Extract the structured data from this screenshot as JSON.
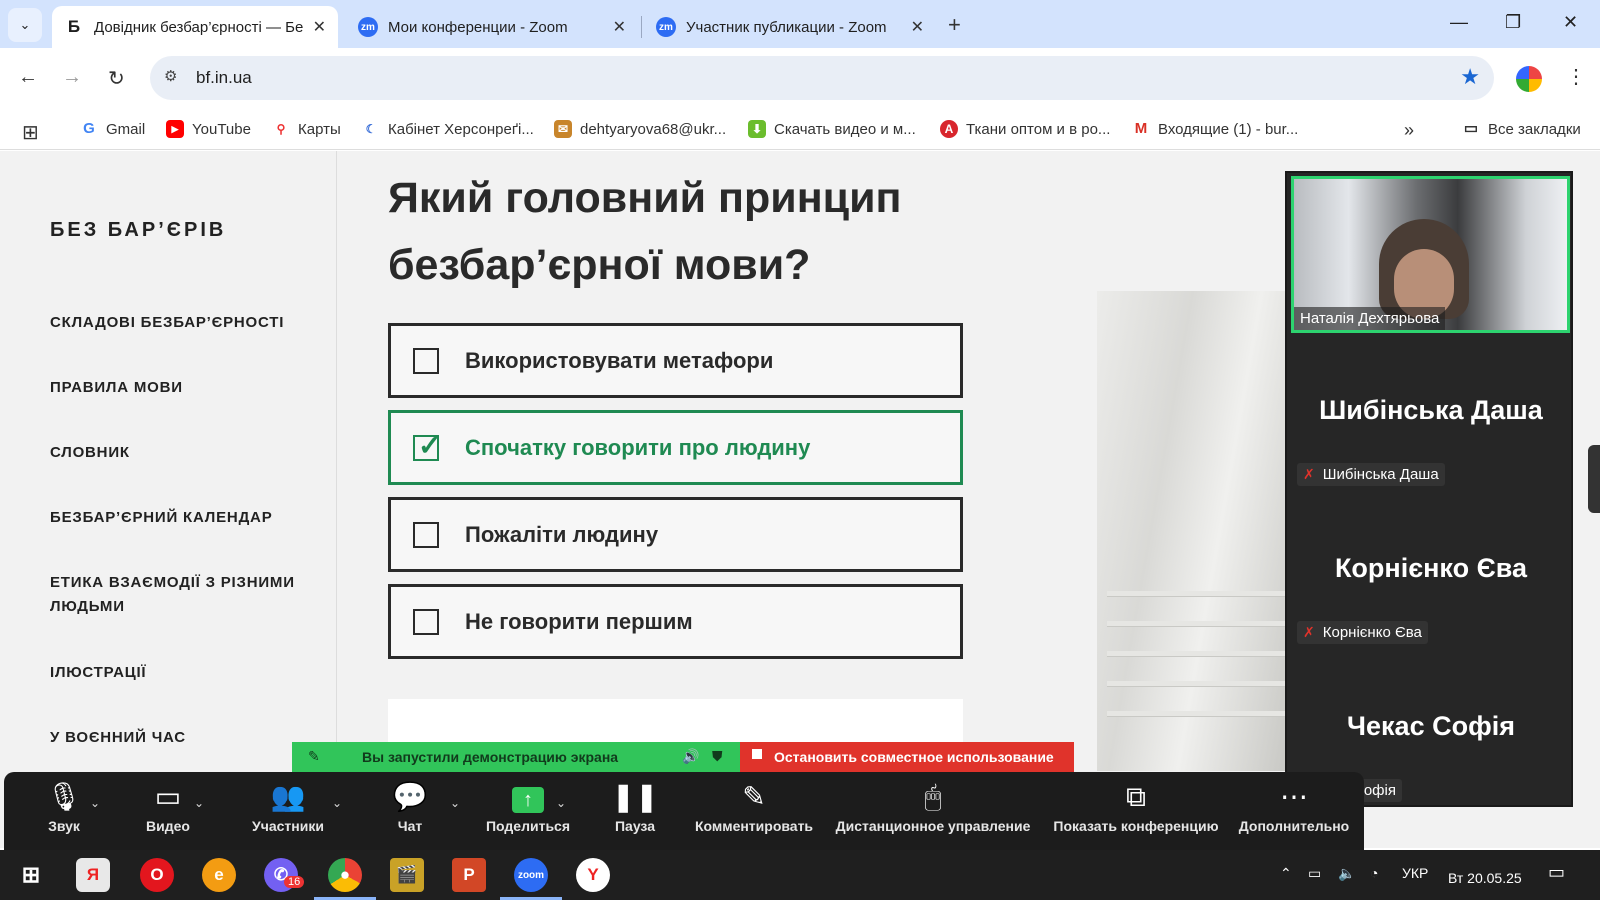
{
  "browser": {
    "tabs": [
      {
        "title": "Довідник безбар’єрності — Бе",
        "favicon": "Б"
      },
      {
        "title": "Мои конференции - Zoom",
        "favicon": "zm"
      },
      {
        "title": "Участник публикации - Zoom",
        "favicon": "zm"
      }
    ],
    "url": "bf.in.ua",
    "bookmarks": [
      {
        "label": "Gmail",
        "icon": "G"
      },
      {
        "label": "YouTube",
        "icon": "▶"
      },
      {
        "label": "Карты",
        "icon": "⚲"
      },
      {
        "label": "Кабінет Херсонреґі...",
        "icon": "☾"
      },
      {
        "label": "dehtyaryova68@ukr...",
        "icon": "✉"
      },
      {
        "label": "Скачать видео и м...",
        "icon": "⬇"
      },
      {
        "label": "Ткани оптом и в ро...",
        "icon": "A"
      },
      {
        "label": "Входящие (1) - bur...",
        "icon": "M"
      }
    ],
    "all_bookmarks": "Все закладки"
  },
  "site": {
    "brand": "БЕЗ БАР’ЄРІВ",
    "nav": [
      "СКЛАДОВІ БЕЗБАР’ЄРНОСТІ",
      "ПРАВИЛА МОВИ",
      "СЛОВНИК",
      "БЕЗБАР’ЄРНИЙ КАЛЕНДАР",
      "ЕТИКА ВЗАЄМОДІЇ З РІЗНИМИ ЛЮДЬМИ",
      "ІЛЮСТРАЦІЇ",
      "У ВОЄННИЙ ЧАС"
    ],
    "question": "Який головний принцип безбар’єрної мови?",
    "options": [
      {
        "label": "Використовувати метафори",
        "checked": false
      },
      {
        "label": "Спочатку говорити про людину",
        "checked": true
      },
      {
        "label": "Пожаліти людину",
        "checked": false
      },
      {
        "label": "Не говорити першим",
        "checked": false
      }
    ]
  },
  "zoom": {
    "video_name": "Наталія Дехтярьова",
    "participants": [
      {
        "display": "Шибінська Даша",
        "label": "Шибінська Даша"
      },
      {
        "display": "Корнієнко Єва",
        "label": "Корнієнко Єва"
      },
      {
        "display": "Чекас Софія",
        "label": "Софія"
      }
    ],
    "share_banner": "Вы запустили демонстрацию экрана",
    "stop_share": "Остановить совместное использование",
    "toolbar": [
      "Звук",
      "Видео",
      "Участники",
      "Чат",
      "Поделиться",
      "Пауза",
      "Комментировать",
      "Дистанционное управление",
      "Показать конференцию",
      "Дополнительно"
    ]
  },
  "taskbar": {
    "badge": "16",
    "lang": "УКР",
    "date": "Вт 20.05.25"
  },
  "colors": {
    "correct": "#1f8a52",
    "share_green": "#31c55a",
    "stop_red": "#e0332b",
    "speaker_border": "#2dd36f"
  }
}
